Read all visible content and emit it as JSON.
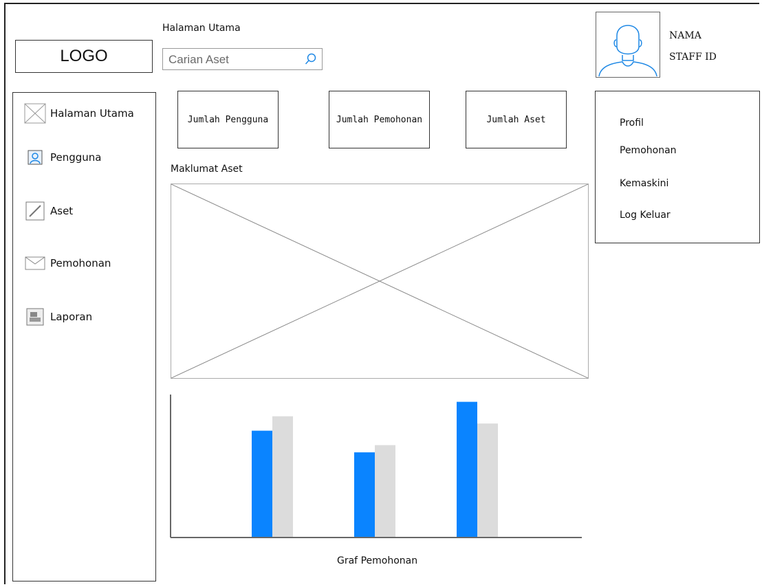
{
  "header": {
    "page_title": "Halaman Utama",
    "logo_text": "LOGO",
    "search_placeholder": "Carian Aset"
  },
  "user": {
    "name": "NAMA",
    "staff_id": "STAFF ID"
  },
  "sidebar": {
    "items": [
      {
        "label": "Halaman Utama",
        "icon": "image-placeholder-icon"
      },
      {
        "label": "Pengguna",
        "icon": "user-icon"
      },
      {
        "label": "Aset",
        "icon": "edit-icon"
      },
      {
        "label": "Pemohonan",
        "icon": "mail-icon"
      },
      {
        "label": "Laporan",
        "icon": "report-icon"
      }
    ]
  },
  "stats": [
    {
      "label": "Jumlah Pengguna"
    },
    {
      "label": "Jumlah Pemohonan"
    },
    {
      "label": "Jumlah Aset"
    }
  ],
  "main": {
    "section_label": "Maklumat Aset"
  },
  "user_menu": {
    "items": [
      "Profil",
      "Pemohonan",
      "Kemaskini",
      "Log Keluar"
    ]
  },
  "chart_data": {
    "type": "bar",
    "title": "Graf Pemohonan",
    "categories": [
      "",
      "",
      ""
    ],
    "series": [
      {
        "values": [
          74,
          59,
          94
        ],
        "color": "#0a84ff"
      },
      {
        "values": [
          84,
          64,
          79
        ],
        "color": "#dcdcdc"
      }
    ],
    "ylim": [
      0,
      100
    ],
    "grid": false
  },
  "colors": {
    "accent": "#0a84ff",
    "secondary_bar": "#dcdcdc"
  }
}
